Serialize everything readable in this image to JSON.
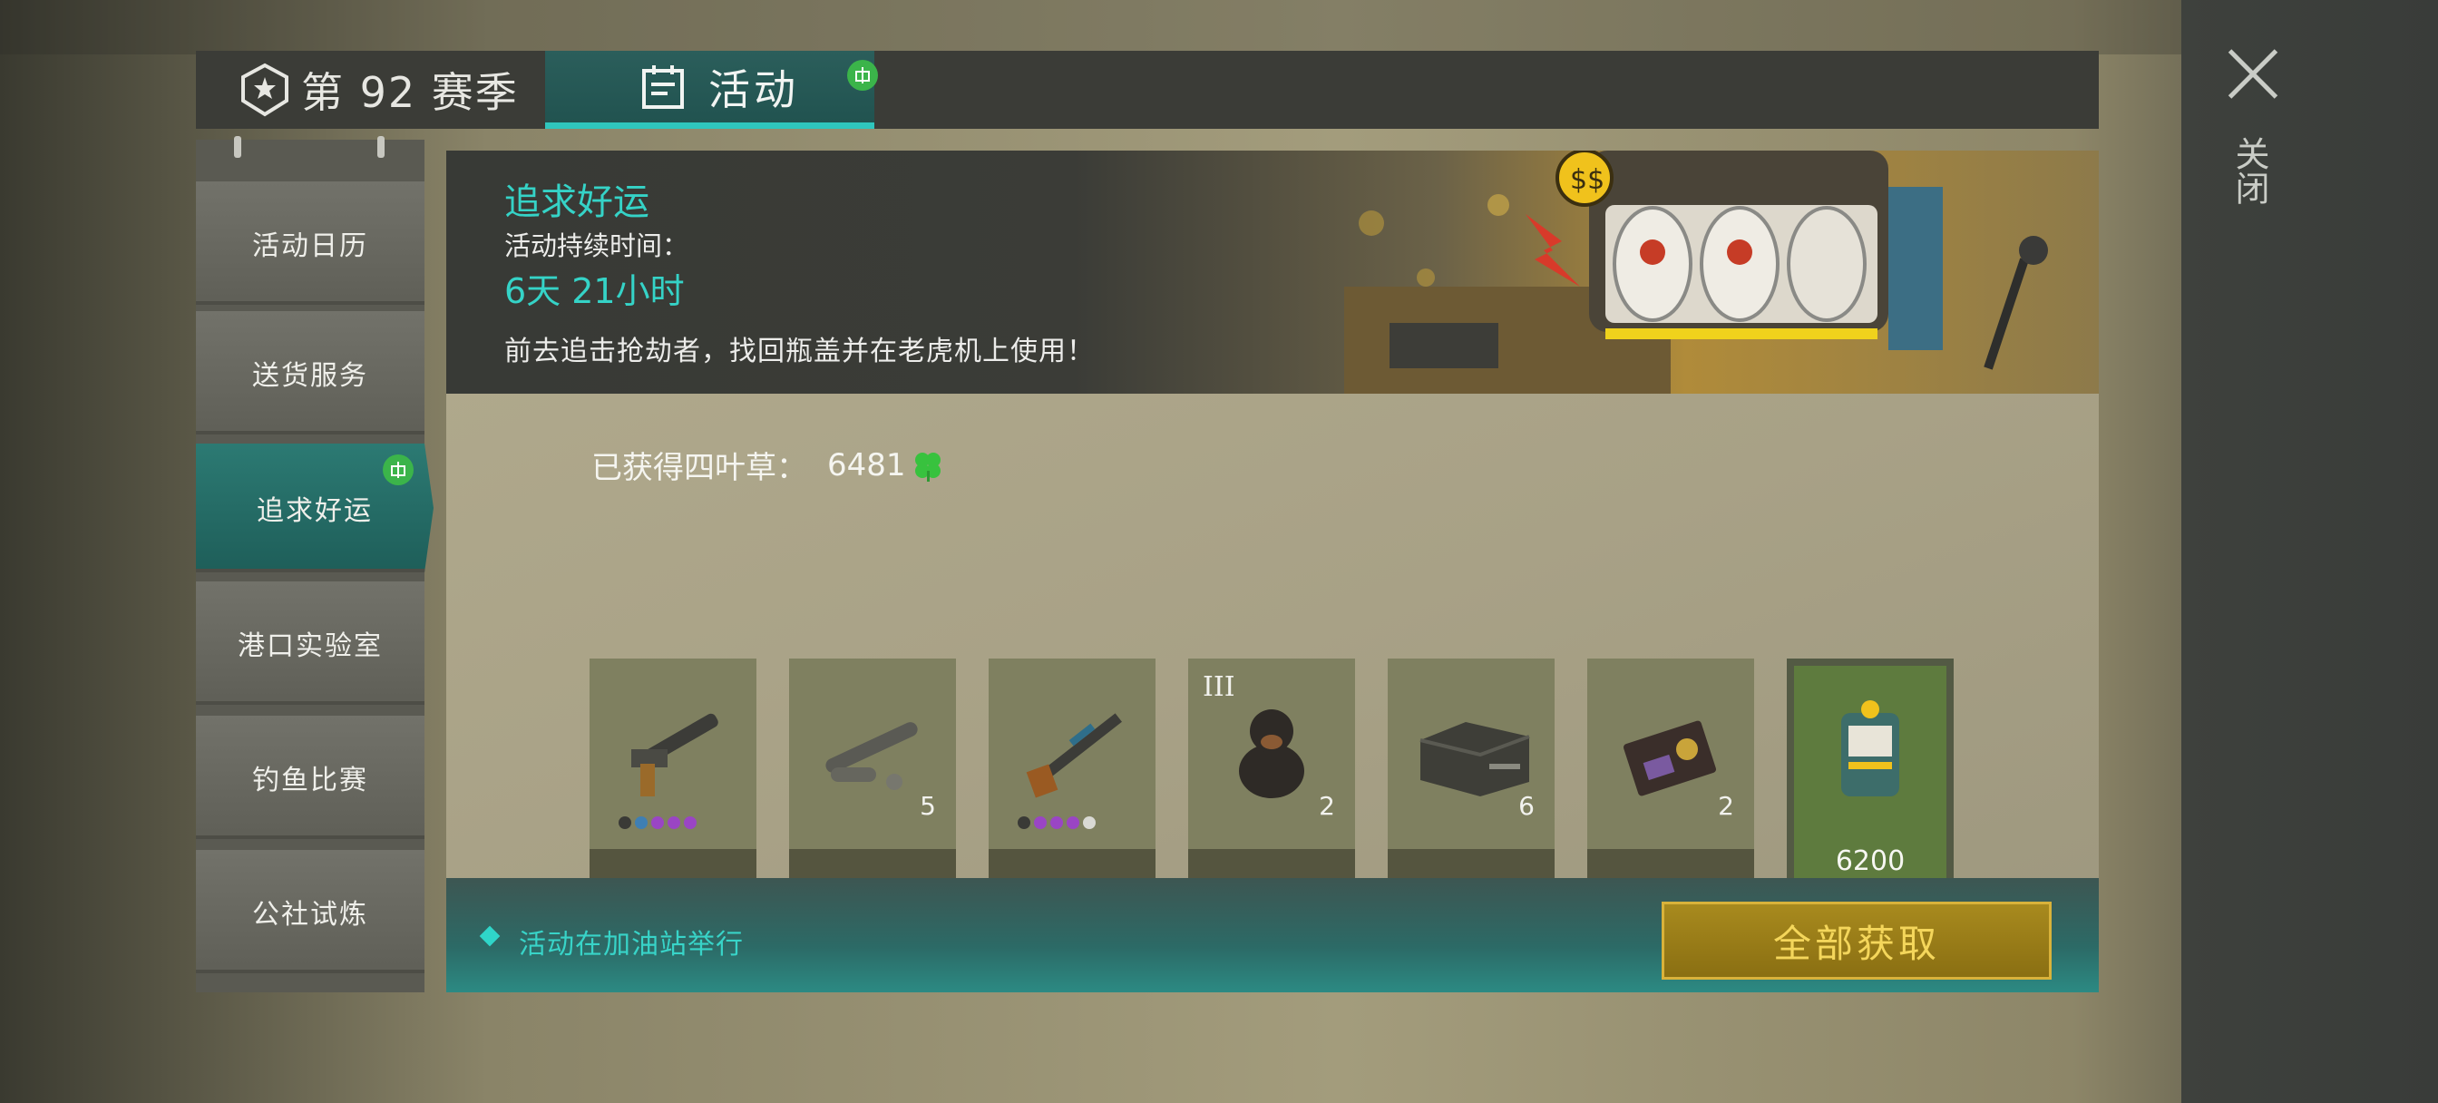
{
  "header": {
    "season_tab": "第 92 赛季",
    "activity_tab": "活动",
    "close_label": "关闭"
  },
  "sidebar": {
    "items": [
      {
        "label": "活动日历"
      },
      {
        "label": "送货服务"
      },
      {
        "label": "追求好运",
        "active": true
      },
      {
        "label": "港口实验室"
      },
      {
        "label": "钓鱼比赛"
      },
      {
        "label": "公社试炼"
      }
    ]
  },
  "event": {
    "title": "追求好运",
    "duration_label": "活动持续时间：",
    "duration": "6天 21小时",
    "description": "前去追击抢劫者，找回瓶盖并在老虎机上使用！"
  },
  "progress": {
    "label": "已获得四叶草：",
    "value": "6481",
    "icon": "four-leaf-clover-icon"
  },
  "rewards": [
    {
      "item": "pistol-icon",
      "count": "",
      "claimed": true,
      "dots": [
        "#3a3a36",
        "#3f7fb3",
        "#9a45c4",
        "#9a45c4",
        "#9a45c4"
      ]
    },
    {
      "item": "bazooka-parts-icon",
      "count": "5",
      "claimed": true
    },
    {
      "item": "rifle-icon",
      "count": "",
      "claimed": true,
      "dots": [
        "#3a3a36",
        "#9a45c4",
        "#9a45c4",
        "#9a45c4",
        "#d9d9d4"
      ]
    },
    {
      "item": "dog-icon",
      "count": "2",
      "roman": "III",
      "claimed": true
    },
    {
      "item": "weapon-crate-icon",
      "count": "6",
      "claimed": true
    },
    {
      "item": "badge-wallet-icon",
      "count": "2",
      "claimed": true
    },
    {
      "item": "slot-machine-icon",
      "price": "6200",
      "claimed": false
    }
  ],
  "footer": {
    "note": "活动在加油站举行",
    "claim_all": "全部获取"
  },
  "colors": {
    "accent_teal": "#35d3c7",
    "check_green": "#38c23e",
    "button_gold": "#a88a1e"
  }
}
